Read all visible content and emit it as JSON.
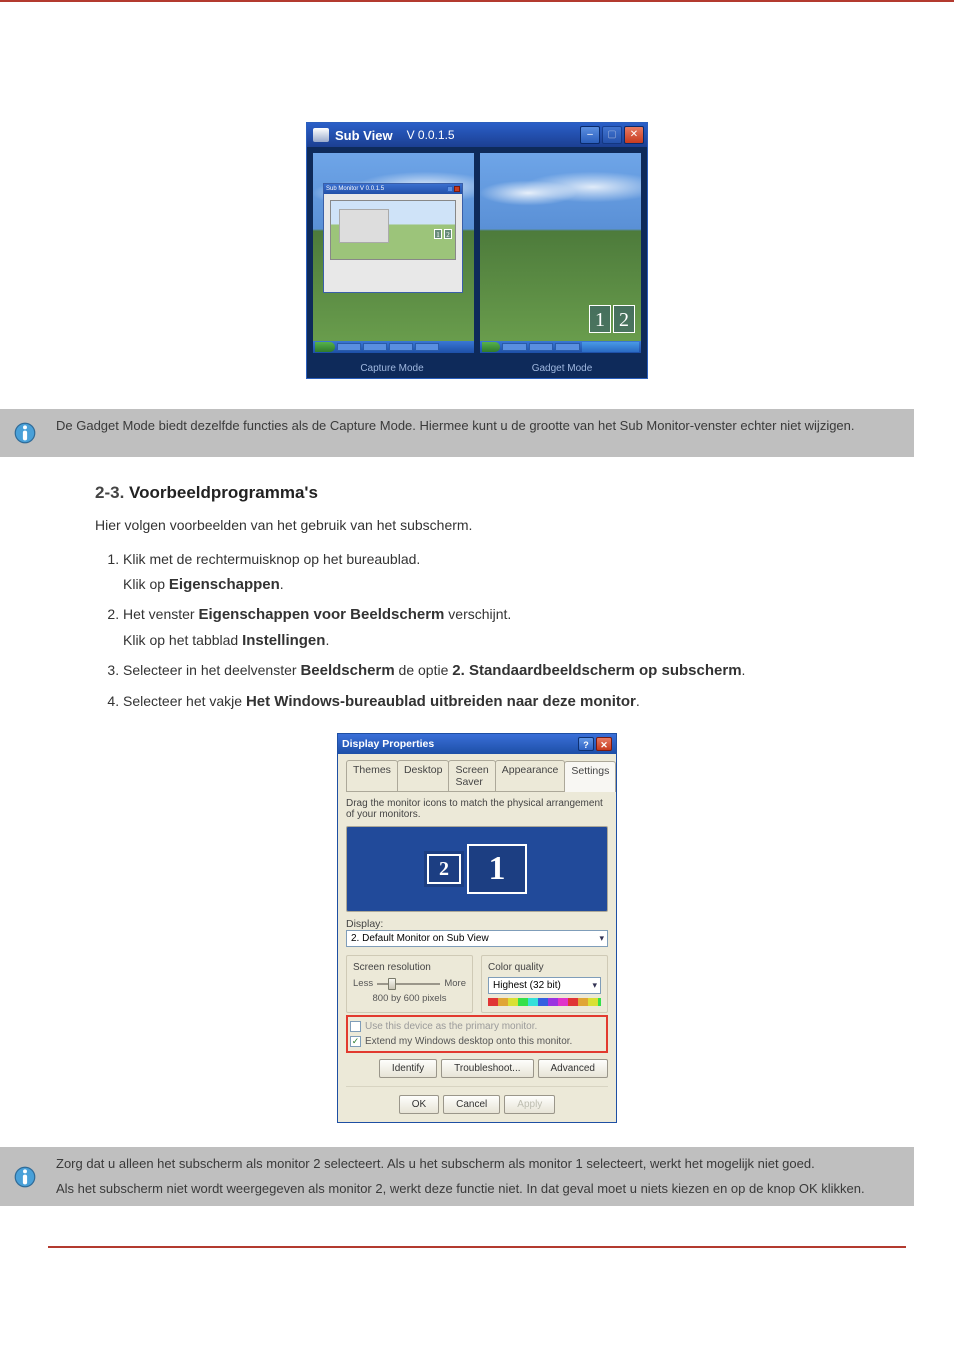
{
  "subview": {
    "app_title": "Sub View",
    "version": "V 0.0.1.5",
    "inner_window_title": "Sub Monitor V 0.0.1.5",
    "left_caption": "Capture Mode",
    "right_caption": "Gadget Mode",
    "left_numbers": [
      "1",
      "2"
    ],
    "right_numbers": [
      "1",
      "2"
    ]
  },
  "info_band_1": {
    "text": "De Gadget Mode biedt dezelfde functies als de Capture Mode. Hiermee kunt u de grootte van het Sub Monitor-venster echter niet wijzigen."
  },
  "section_heading": {
    "number": "2-3.",
    "title": "Voorbeeldprogramma's"
  },
  "lead_para": "Hier volgen voorbeelden van het gebruik van het subscherm.",
  "steps": [
    {
      "pre": "Klik met de rechtermuisknop op het bureaublad.",
      "mid": "Klik op ",
      "bold": "Eigenschappen",
      "post": "."
    },
    {
      "pre": "Het venster ",
      "bold": "Eigenschappen voor Beeldscherm",
      "post": " verschijnt.",
      "mid2": "Klik op het tabblad ",
      "bold2": "Instellingen",
      "post2": "."
    },
    {
      "pre": "Selecteer in het deelvenster ",
      "bold": "Beeldscherm",
      "post": " de optie ",
      "bold2": "2. Standaardbeeldscherm op subscherm",
      "post2": "."
    },
    {
      "pre": "Selecteer het vakje ",
      "bold": "Het Windows-bureaublad uitbreiden naar deze monitor",
      "post": "."
    }
  ],
  "display_props": {
    "title": "Display Properties",
    "tabs": [
      "Themes",
      "Desktop",
      "Screen Saver",
      "Appearance",
      "Settings"
    ],
    "hint": "Drag the monitor icons to match the physical arrangement of your monitors.",
    "monitors": [
      "2",
      "1"
    ],
    "display_label": "Display:",
    "display_select": "2. Default Monitor on Sub View",
    "res_group": "Screen resolution",
    "res_less": "Less",
    "res_more": "More",
    "res_readout": "800 by 600 pixels",
    "cq_group": "Color quality",
    "cq_select": "Highest (32 bit)",
    "cb_disabled": "Use this device as the primary monitor.",
    "cb_extend": "Extend my Windows desktop onto this monitor.",
    "btns_row1": [
      "Identify",
      "Troubleshoot...",
      "Advanced"
    ],
    "btns_row2": [
      "OK",
      "Cancel",
      "Apply"
    ]
  },
  "info_band_2": {
    "line1": "Zorg dat u alleen het subscherm als monitor 2 selecteert. Als u het subscherm als monitor 1 selecteert, werkt het mogelijk niet goed.",
    "line2": "Als het subscherm niet wordt weergegeven als monitor 2, werkt deze functie niet. In dat geval moet u niets kiezen en op de knop OK klikken."
  }
}
